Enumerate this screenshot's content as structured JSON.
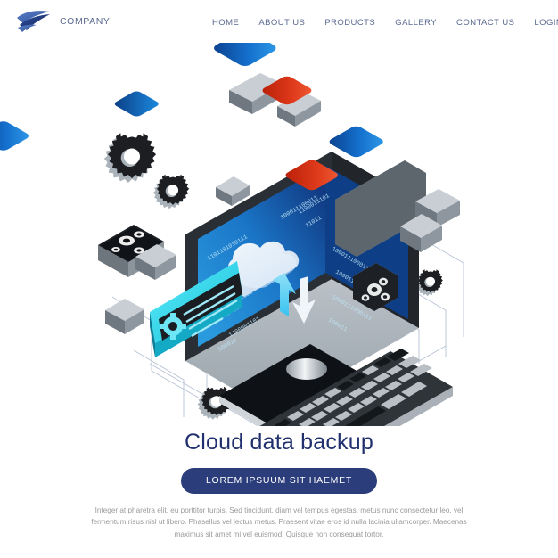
{
  "header": {
    "logo_icon": "swoosh-bird-logo",
    "brand_name": "COMPANY",
    "nav": [
      {
        "label": "HOME"
      },
      {
        "label": "ABOUT US"
      },
      {
        "label": "PRODUCTS"
      },
      {
        "label": "GALLERY"
      },
      {
        "label": "CONTACT US"
      },
      {
        "label": "LOGIN/REGISTER"
      }
    ]
  },
  "hero": {
    "title": "Cloud data backup",
    "cta_label": "LOREM IPSUUM SIT HAEMET",
    "paragraph": "Integer at pharetra elit, eu porttitor turpis. Sed tincidunt, diam vel tempus egestas, metus nunc consectetur leo, vel fermentum risus nisl ut libero. Phasellus vel lectus metus. Praesent vitae eros id nulla lacinia ullamcorper. Maecenas maximus sit amet mi vel euismod. Quisque non consequat tortor."
  },
  "illustration": {
    "name": "isometric-cloud-data-backup-scene",
    "monitor_screen_binary": [
      "1101101010111",
      "1100001101",
      "1100001101",
      "100011100011",
      "1100001101",
      "11011",
      "100011100011",
      "1000111000111",
      "010101 11",
      "1100001101",
      "100011"
    ],
    "cloud_icon": "cloud-upload-download-icon",
    "gear_icons": [
      "gear-large",
      "gear-medium",
      "gear-small",
      "gear-bottom"
    ],
    "tile_colors": {
      "blue": "#1877d4",
      "blue_dark": "#0b3f86",
      "red": "#dd3318",
      "orange": "#f0a716",
      "cyan": "#27d5ef",
      "panel_dark": "#22262b",
      "panel_gray": "#5d666d"
    }
  },
  "colors": {
    "brand_navy": "#21306e",
    "cta_bg": "#2c3d7b",
    "nav_text": "#5b6a90",
    "body_text": "#9a9a9a",
    "page_bg": "#ffffff"
  }
}
